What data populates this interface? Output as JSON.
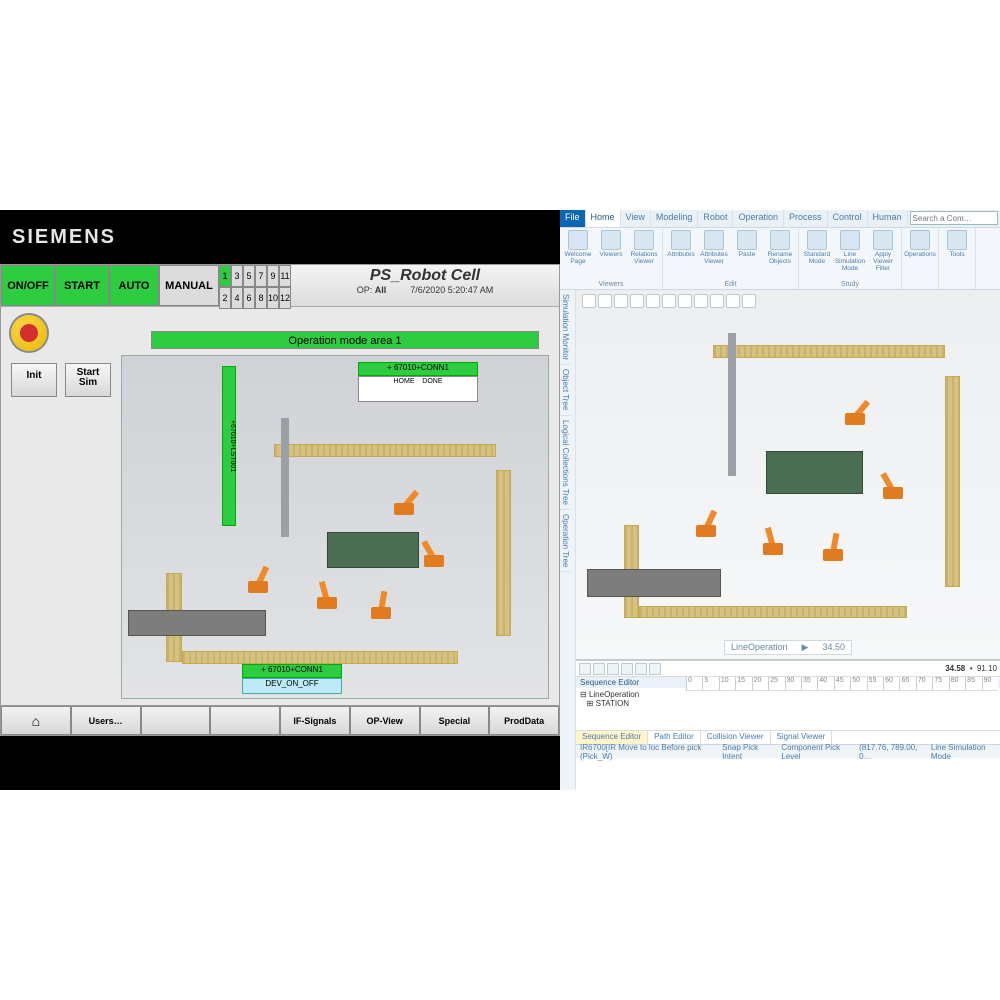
{
  "hmi": {
    "brand": "SIEMENS",
    "buttons": {
      "onoff": "ON/OFF",
      "start": "START",
      "auto": "AUTO",
      "manual": "MANUAL"
    },
    "numbers_row1": [
      "1",
      "3",
      "5",
      "7",
      "9",
      "11"
    ],
    "numbers_row2": [
      "2",
      "4",
      "6",
      "8",
      "10",
      "12"
    ],
    "active_num": "1",
    "title": "PS_Robot Cell",
    "op_label": "OP:",
    "op_value": "All",
    "timestamp": "7/6/2020 5:20:47 AM",
    "op_mode": "Operation mode area 1",
    "init": "Init",
    "startsim_l1": "Start",
    "startsim_l2": "Sim",
    "overlay1": "+ 67010+CONN1",
    "overlay1b_l": "HOME",
    "overlay1b_r": "DONE",
    "overlay2": "+ 67010+CONN1",
    "overlay2b": "DEV_ON_OFF",
    "vstrip": "+67010+LST001",
    "bottom": {
      "home": "⌂",
      "users": "Users…",
      "b3": "",
      "b4": "",
      "ifsignals": "IF-Signals",
      "opview": "OP-View",
      "special": "Special",
      "proddata": "ProdData"
    }
  },
  "app": {
    "tabs": [
      "File",
      "Home",
      "View",
      "Modeling",
      "Robot",
      "Operation",
      "Process",
      "Control",
      "Human"
    ],
    "search_placeholder": "Search a Com…",
    "ribbon_groups": [
      {
        "label": "Viewers",
        "items": [
          "Welcome Page",
          "Viewers",
          "Relations Viewer"
        ]
      },
      {
        "label": "Edit",
        "items": [
          "Attributes",
          "Attributes Viewer",
          "Paste",
          "Rename Objects"
        ]
      },
      {
        "label": "Study",
        "items": [
          "Standard Mode",
          "Line Simulation Mode",
          "Apply Viewer Filter"
        ]
      },
      {
        "label": "",
        "items": [
          "Operations"
        ]
      },
      {
        "label": "",
        "items": [
          "Tools"
        ]
      }
    ],
    "side_tabs": [
      "Simulation Monitor",
      "Object Tree",
      "Logical Collections Tree",
      "Operation Tree"
    ],
    "view_status_label": "LineOperation",
    "view_status_play": "▶",
    "view_status_time": "34.50",
    "seq": {
      "title": "Sequence Editor",
      "tree_root": "LineOperation",
      "tree_child": "STATION",
      "time_current": "34.58",
      "time_end": "91.10",
      "ruler": [
        "0",
        "5",
        "10",
        "15",
        "20",
        "25",
        "30",
        "35",
        "40",
        "45",
        "50",
        "55",
        "60",
        "65",
        "70",
        "75",
        "80",
        "85",
        "90"
      ],
      "tabs": [
        "Sequence Editor",
        "Path Editor",
        "Collision Viewer",
        "Signal Viewer"
      ]
    },
    "status": {
      "obj": "IR6700[IR Move to loc Before pick (Pick_W)",
      "snap": "Snap Pick Intent",
      "pick": "Component Pick Level",
      "coords": "(817.76, 789.00, 0…",
      "mode": "Line Simulation Mode"
    }
  },
  "colors": {
    "green": "#2ecc40",
    "orange": "#f08a28",
    "siemens_teal": "#009999"
  }
}
